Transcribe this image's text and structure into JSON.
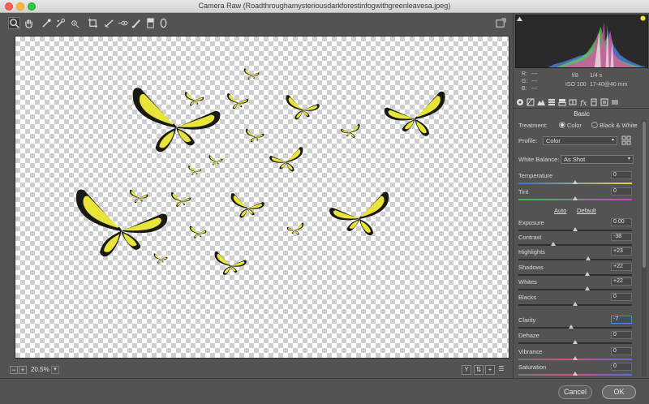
{
  "window": {
    "title": "Camera Raw (Roadthroughamysteriousdarkforestinfogwithgreenleavesa.jpeg)"
  },
  "toolbar": {
    "tools": [
      "zoom-icon",
      "hand-icon",
      "white-balance-icon",
      "color-sampler-icon",
      "targeted-adjustment-icon",
      "crop-icon",
      "straighten-icon",
      "red-eye-icon",
      "adjustment-brush-icon",
      "graduated-filter-icon",
      "radial-filter-icon"
    ],
    "open_preferences": "preferences-icon"
  },
  "status": {
    "zoom": "20.5%"
  },
  "info": {
    "r_label": "R:",
    "r_value": "---",
    "g_label": "G:",
    "g_value": "---",
    "b_label": "B:",
    "b_value": "---",
    "aperture": "f/8",
    "shutter": "1/4 s",
    "iso": "ISO 100",
    "lens": "17-40@40 mm"
  },
  "panel": {
    "section": "Basic",
    "treatment_label": "Treatment:",
    "treatment_color": "Color",
    "treatment_bw": "Black & White",
    "profile_label": "Profile:",
    "profile_value": "Color",
    "wb_label": "White Balance:",
    "wb_value": "As Shot",
    "auto": "Auto",
    "default": "Default",
    "sliders": [
      {
        "label": "Temperature",
        "value": "0",
        "pos": 0.5
      },
      {
        "label": "Tint",
        "value": "0",
        "pos": 0.5
      },
      {
        "label": "Exposure",
        "value": "0.00",
        "pos": 0.5
      },
      {
        "label": "Contrast",
        "value": "-38",
        "pos": 0.31
      },
      {
        "label": "Highlights",
        "value": "+23",
        "pos": 0.615
      },
      {
        "label": "Shadows",
        "value": "+22",
        "pos": 0.61
      },
      {
        "label": "Whites",
        "value": "+22",
        "pos": 0.61
      },
      {
        "label": "Blacks",
        "value": "0",
        "pos": 0.5
      },
      {
        "label": "Clarity",
        "value": "-7",
        "pos": 0.465
      },
      {
        "label": "Dehaze",
        "value": "0",
        "pos": 0.5
      },
      {
        "label": "Vibrance",
        "value": "0",
        "pos": 0.5
      },
      {
        "label": "Saturation",
        "value": "0",
        "pos": 0.5
      }
    ]
  },
  "footer": {
    "cancel": "Cancel",
    "ok": "OK"
  },
  "colors": {
    "accent": "#4b8bd8",
    "butterfly_yellow": "#e8e43a",
    "butterfly_black": "#1a1a14"
  }
}
